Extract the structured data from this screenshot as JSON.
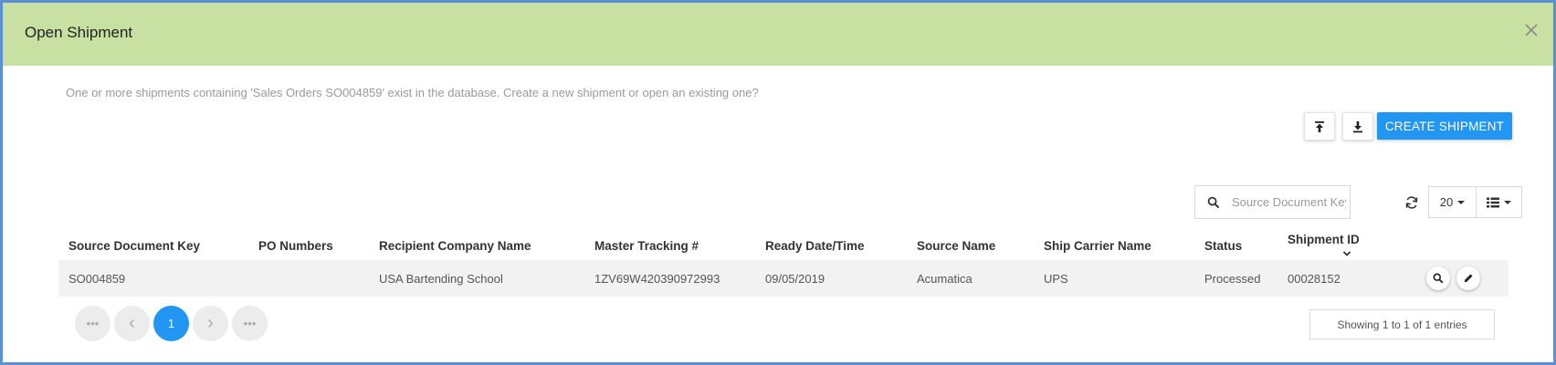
{
  "dialog": {
    "title": "Open Shipment",
    "message": "One or more shipments containing 'Sales Orders SO004859' exist in the database. Create a new shipment or open an existing one?"
  },
  "toolbar": {
    "upload_icon": "upload-icon",
    "download_icon": "download-icon",
    "create_label": "CREATE SHIPMENT"
  },
  "search": {
    "placeholder": "Source Document Key",
    "value": ""
  },
  "page_size": {
    "value": "20"
  },
  "table": {
    "columns": [
      "Source Document Key",
      "PO Numbers",
      "Recipient Company Name",
      "Master Tracking #",
      "Ready Date/Time",
      "Source Name",
      "Ship Carrier Name",
      "Status",
      "Shipment ID"
    ],
    "rows": [
      {
        "source_document_key": "SO004859",
        "po_numbers": "",
        "recipient_company_name": "USA Bartending School",
        "master_tracking": "1ZV69W420390972993",
        "ready_datetime": "09/05/2019",
        "source_name": "Acumatica",
        "ship_carrier_name": "UPS",
        "status": "Processed",
        "shipment_id": "00028152"
      }
    ]
  },
  "pager": {
    "first": "•••",
    "prev": "‹",
    "current": "1",
    "next": "›",
    "last": "•••"
  },
  "footer": {
    "entries": "Showing 1 to 1 of 1 entries"
  },
  "colors": {
    "header_bg": "#c8e0a2",
    "accent": "#2196f3",
    "border": "#5b8fd6"
  }
}
